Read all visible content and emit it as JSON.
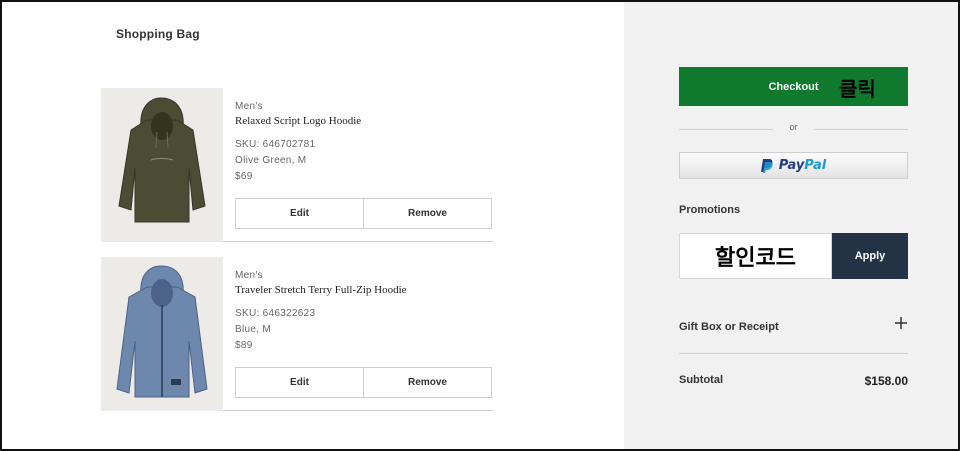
{
  "bag": {
    "title": "Shopping Bag",
    "items": [
      {
        "gender": "Men's",
        "name": "Relaxed Script Logo Hoodie",
        "sku": "SKU: 646702781",
        "variant": "Olive Green, M",
        "price": "$69",
        "edit_label": "Edit",
        "remove_label": "Remove",
        "color": "#4b4c33"
      },
      {
        "gender": "Men's",
        "name": "Traveler Stretch Terry Full-Zip Hoodie",
        "sku": "SKU: 646322623",
        "variant": "Blue, M",
        "price": "$89",
        "edit_label": "Edit",
        "remove_label": "Remove",
        "color": "#6e87ad"
      }
    ]
  },
  "summary": {
    "checkout_label": "Checkout",
    "checkout_overlay": "클릭",
    "or_text": "or",
    "paypal_a": "Pay",
    "paypal_b": "Pal",
    "promotions_label": "Promotions",
    "promo_code_value": "할인코드",
    "apply_label": "Apply",
    "gift_label": "Gift Box or Receipt",
    "gift_icon": "plus-icon",
    "subtotal_label": "Subtotal",
    "subtotal_value": "$158.00"
  },
  "colors": {
    "checkout": "#0f7a2e",
    "apply": "#243245",
    "summary_bg": "#f1f1f1",
    "paypal_dark": "#253b80",
    "paypal_light": "#179bd7"
  }
}
